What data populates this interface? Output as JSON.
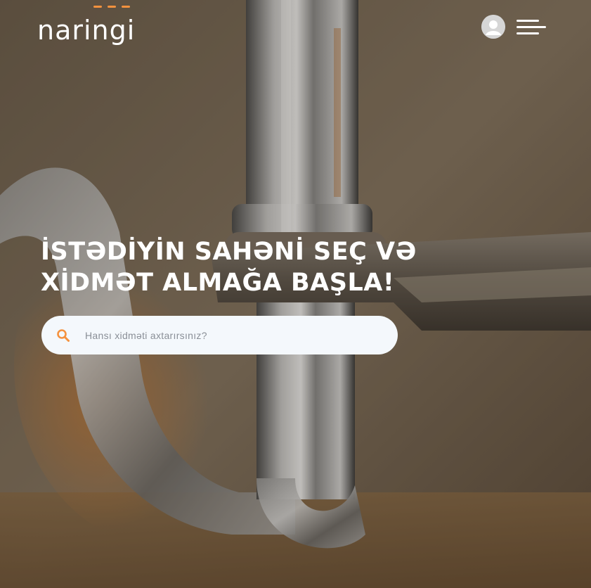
{
  "header": {
    "logo_text": "naringi",
    "user_avatar_icon": "user-avatar-icon",
    "menu_icon": "hamburger-menu-icon"
  },
  "hero": {
    "headline_line1": "İSTƏDİYİN SAHƏNİ SEÇ VƏ",
    "headline_line2": "XİDMƏT ALMAĞA BAŞLA!",
    "background_image": "plumber-wrench-on-chrome-pipe"
  },
  "search": {
    "placeholder": "Hansı xidməti axtarırsınız?",
    "value": "",
    "icon": "search-icon"
  },
  "colors": {
    "accent": "#f5923e",
    "text_light": "#ffffff",
    "search_bg": "#f4f8fc",
    "placeholder": "#8a8f97"
  }
}
